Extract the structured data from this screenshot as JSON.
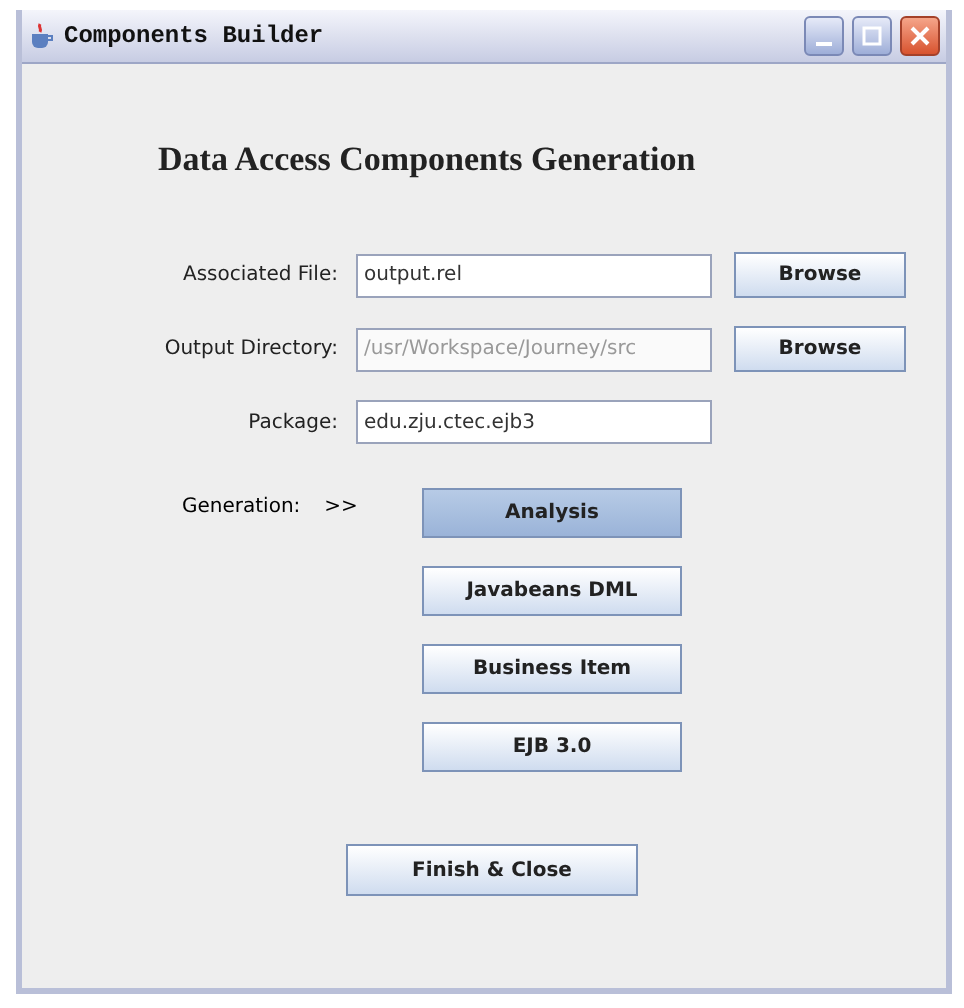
{
  "window": {
    "title": "Components Builder"
  },
  "heading": "Data Access Components Generation",
  "fields": [
    {
      "label": "Associated File:",
      "value": "output.rel",
      "disabled": false,
      "button": "Browse"
    },
    {
      "label": "Output Directory:",
      "value": "/usr/Workspace/Journey/src",
      "disabled": true,
      "button": "Browse"
    },
    {
      "label": "Package:",
      "value": "edu.zju.ctec.ejb3",
      "disabled": false
    }
  ],
  "generation": {
    "label": "Generation:",
    "arrow": ">>",
    "buttons": [
      {
        "label": "Analysis",
        "selected": true
      },
      {
        "label": "Javabeans DML",
        "selected": false
      },
      {
        "label": "Business Item",
        "selected": false
      },
      {
        "label": "EJB 3.0",
        "selected": false
      }
    ]
  },
  "finish_button": "Finish & Close"
}
